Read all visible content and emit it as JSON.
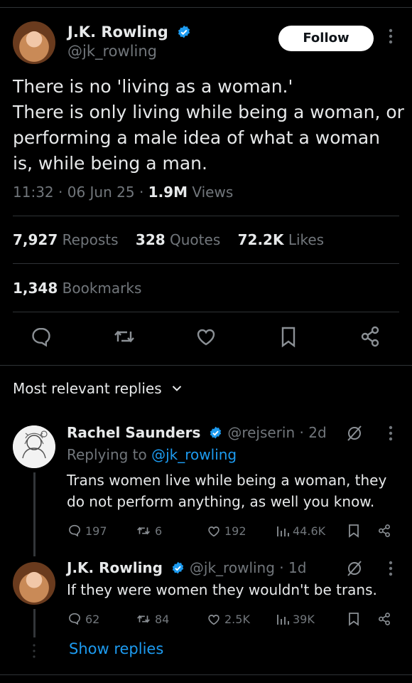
{
  "main_tweet": {
    "author_name": "J.K. Rowling",
    "author_handle": "@jk_rowling",
    "follow_label": "Follow",
    "text_lines": [
      "There is no 'living as a woman.'",
      "There is only living while being a woman, or",
      "performing a male idea of what a woman",
      "is, while being a man."
    ],
    "time": "11:32",
    "date": "06 Jun 25",
    "views_count": "1.9M",
    "views_label": "Views",
    "reposts_count": "7,927",
    "reposts_label": "Reposts",
    "quotes_count": "328",
    "quotes_label": "Quotes",
    "likes_count": "72.2K",
    "likes_label": "Likes",
    "bookmarks_count": "1,348",
    "bookmarks_label": "Bookmarks"
  },
  "replies_header": {
    "label": "Most relevant replies"
  },
  "replies": [
    {
      "author_name": "Rachel Saunders",
      "author_handle": "@rejserin",
      "age": "2d",
      "replying_prefix": "Replying to",
      "replying_to": "@jk_rowling",
      "text_lines": [
        "Trans women live while being a woman, they",
        "do not perform anything, as well you know."
      ],
      "replies": "197",
      "reposts": "6",
      "likes": "192",
      "views": "44.6K"
    },
    {
      "author_name": "J.K. Rowling",
      "author_handle": "@jk_rowling",
      "age": "1d",
      "text_lines": [
        "If they were women they wouldn't be trans."
      ],
      "replies": "62",
      "reposts": "84",
      "likes": "2.5K",
      "views": "39K"
    }
  ],
  "show_replies_label": "Show replies",
  "colors": {
    "background": "#000000",
    "text": "#e7e9ea",
    "muted": "#71767b",
    "accent": "#1d9bf0",
    "divider": "#2f3336"
  },
  "icons": [
    "verified-badge-icon",
    "kebab-icon",
    "reply-icon",
    "repost-icon",
    "like-icon",
    "bookmark-icon",
    "share-icon",
    "views-icon",
    "grok-icon",
    "chevron-down-icon"
  ]
}
